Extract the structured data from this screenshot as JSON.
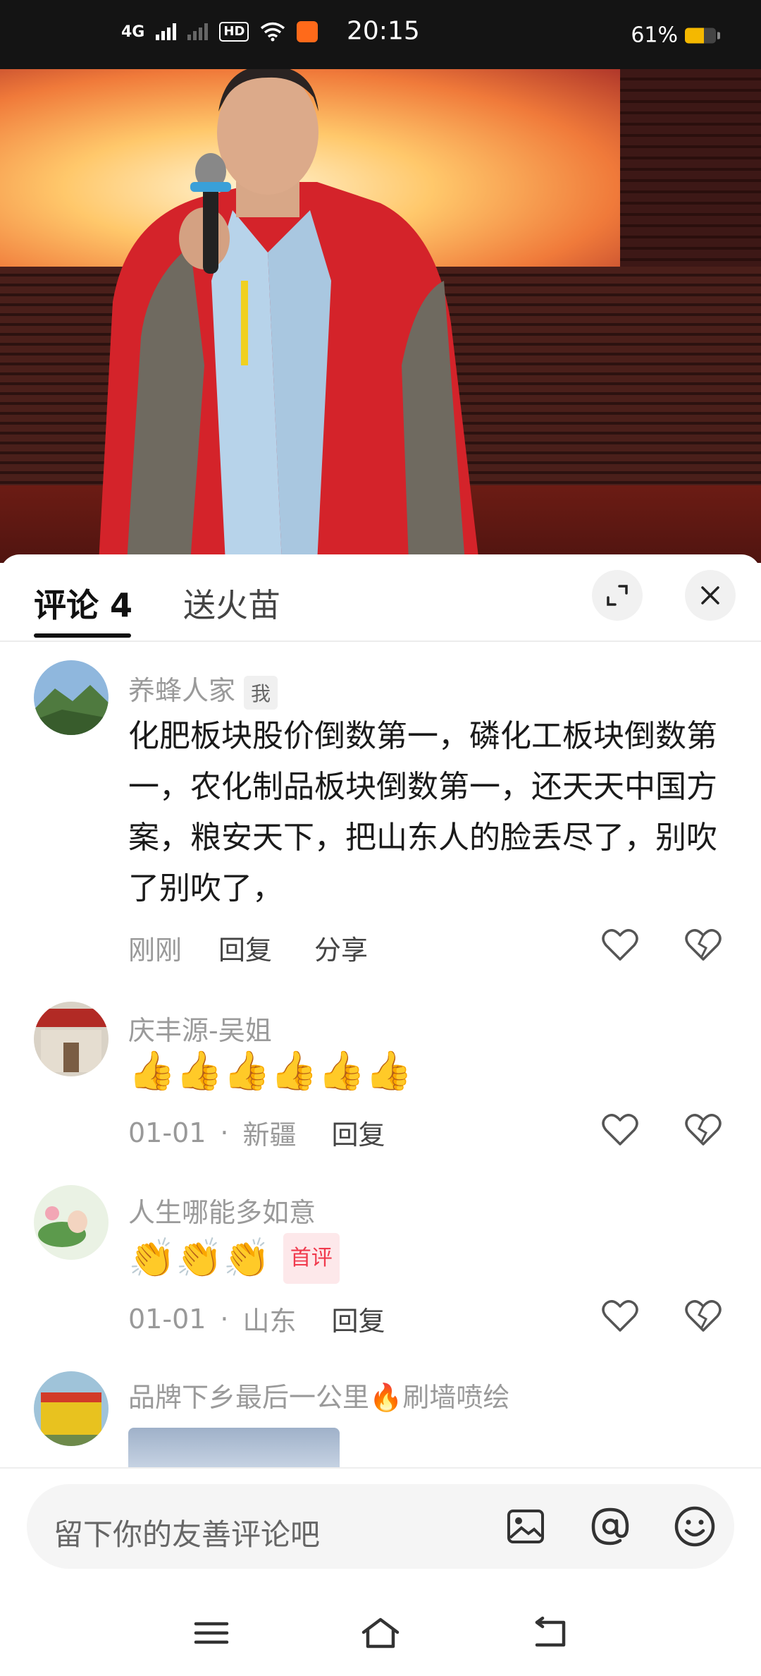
{
  "status_bar": {
    "network": "4G",
    "hd_label": "HD",
    "time": "20:15",
    "battery_percent_label": "61%",
    "battery_level": 0.61
  },
  "video": {
    "description_icon": "video-frame"
  },
  "comments_panel": {
    "tabs": [
      {
        "label": "评论 4"
      },
      {
        "label": "送火苗"
      }
    ],
    "comments": [
      {
        "name": "养蜂人家",
        "badge": "我",
        "text": "化肥板块股价倒数第一，磷化工板块倒数第一，农化制品板块倒数第一，还天天中国方案，粮安天下，把山东人的脸丢尽了，别吹了别吹了，",
        "time": "刚刚",
        "reply": "回复",
        "share": "分享"
      },
      {
        "name": "庆丰源-吴姐",
        "emojis": "👍👍👍👍👍👍",
        "time": "01-01",
        "sep": "·",
        "location": "新疆",
        "reply": "回复"
      },
      {
        "name": "人生哪能多如意",
        "emojis": "👏👏👏",
        "first_badge": "首评",
        "time": "01-01",
        "sep": "·",
        "location": "山东",
        "reply": "回复"
      },
      {
        "name": "品牌下乡最后一公里🔥刷墙喷绘"
      }
    ]
  },
  "input": {
    "placeholder": "留下你的友善评论吧"
  },
  "colors": {
    "accent_red": "#f03a4d",
    "text_gray": "#9a9a9a"
  }
}
